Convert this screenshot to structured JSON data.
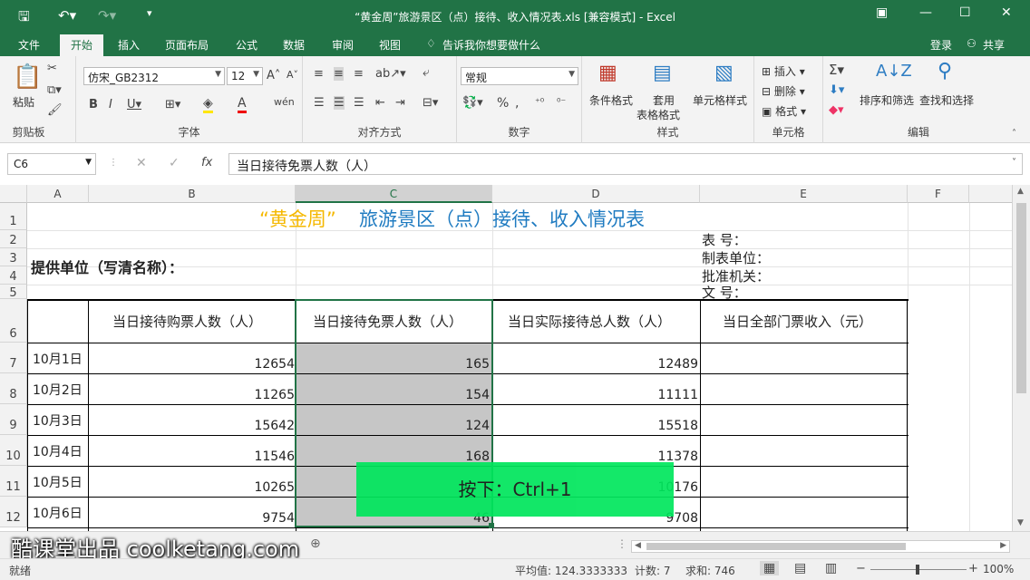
{
  "window": {
    "title": "“黄金周”旅游景区（点）接待、收入情况表.xls  [兼容模式] - Excel"
  },
  "tabs": [
    "文件",
    "开始",
    "插入",
    "页面布局",
    "公式",
    "数据",
    "审阅",
    "视图"
  ],
  "tell_me": "告诉我你想要做什么",
  "login": "登录",
  "share": "共享",
  "ribbon": {
    "clipboard": {
      "paste": "粘贴",
      "label": "剪贴板"
    },
    "font": {
      "name": "仿宋_GB2312",
      "size": "12",
      "label": "字体"
    },
    "align": {
      "label": "对齐方式"
    },
    "number": {
      "format": "常规",
      "label": "数字"
    },
    "styles": {
      "cond": "条件格式",
      "table1": "套用",
      "table2": "表格格式",
      "cell": "单元格样式",
      "label": "样式"
    },
    "cells": {
      "insert": "插入",
      "delete": "删除",
      "format": "格式",
      "label": "单元格"
    },
    "edit": {
      "sort": "排序和筛选",
      "find": "查找和选择",
      "label": "编辑"
    }
  },
  "formula": {
    "namebox": "C6",
    "content": "当日接待免票人数（人）"
  },
  "columns": [
    "A",
    "B",
    "C",
    "D",
    "E",
    "F"
  ],
  "rows": [
    "1",
    "2",
    "3",
    "4",
    "5",
    "6",
    "7",
    "8",
    "9",
    "10",
    "11",
    "12"
  ],
  "sheet": {
    "title_quote": "“黄金周”",
    "title_rest": "旅游景区（点）接待、收入情况表",
    "provider": "提供单位（写清名称）：",
    "meta": [
      "表      号：",
      "制表单位：",
      "批准机关：",
      "文        号："
    ],
    "headers": [
      "当日接待购票人数（人）",
      "当日接待免票人数（人）",
      "当日实际接待总人数（人）",
      "当日全部门票收入（元）"
    ],
    "data": [
      {
        "date": "10月1日",
        "paid": "12654",
        "free": "165",
        "total": "12489"
      },
      {
        "date": "10月2日",
        "paid": "11265",
        "free": "154",
        "total": "11111"
      },
      {
        "date": "10月3日",
        "paid": "15642",
        "free": "124",
        "total": "15518"
      },
      {
        "date": "10月4日",
        "paid": "11546",
        "free": "168",
        "total": "11378"
      },
      {
        "date": "10月5日",
        "paid": "10265",
        "free": "",
        "total": "10176"
      },
      {
        "date": "10月6日",
        "paid": "9754",
        "free": "46",
        "total": "9708"
      }
    ]
  },
  "status": {
    "ready": "就绪",
    "average": "平均值: 124.3333333",
    "count": "计数: 7",
    "sum": "求和: 746",
    "zoom": "100%"
  },
  "overlay": "按下：Ctrl+1",
  "watermark": "酷课堂出品 coolketang.com",
  "colors": {
    "excel_green": "#217346",
    "title_gold": "#f5b800",
    "title_blue": "#1f7bc1",
    "overlay": "#00e65c"
  }
}
